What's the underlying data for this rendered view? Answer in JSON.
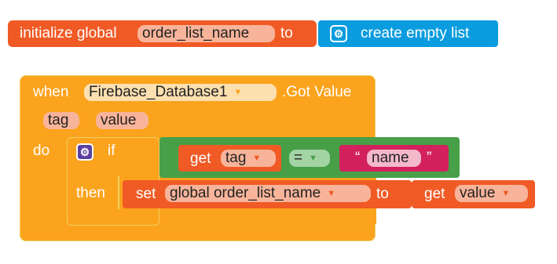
{
  "init_block": {
    "keyword": "initialize global",
    "var_name": "order_list_name",
    "to": "to",
    "create_label": "create empty list",
    "gear_icon": "gear-icon"
  },
  "event_block": {
    "when": "when",
    "component": "Firebase_Database1",
    "event": ".Got Value",
    "params": [
      "tag",
      "value"
    ],
    "do": "do"
  },
  "if_block": {
    "if": "if",
    "then": "then",
    "gear_icon": "gear-icon"
  },
  "compare_block": {
    "get": "get",
    "get_var": "tag",
    "op": "=",
    "open_quote": "“",
    "string_value": "name",
    "close_quote": "”"
  },
  "set_block": {
    "set": "set",
    "var": "global order_list_name",
    "to": "to",
    "get": "get",
    "get_var": "value"
  },
  "colors": {
    "variables": "#f05a25",
    "events": "#fba31c",
    "control": "#fba31c",
    "logic": "#479f48",
    "text": "#d2215d",
    "lists": "#0a9cde"
  }
}
